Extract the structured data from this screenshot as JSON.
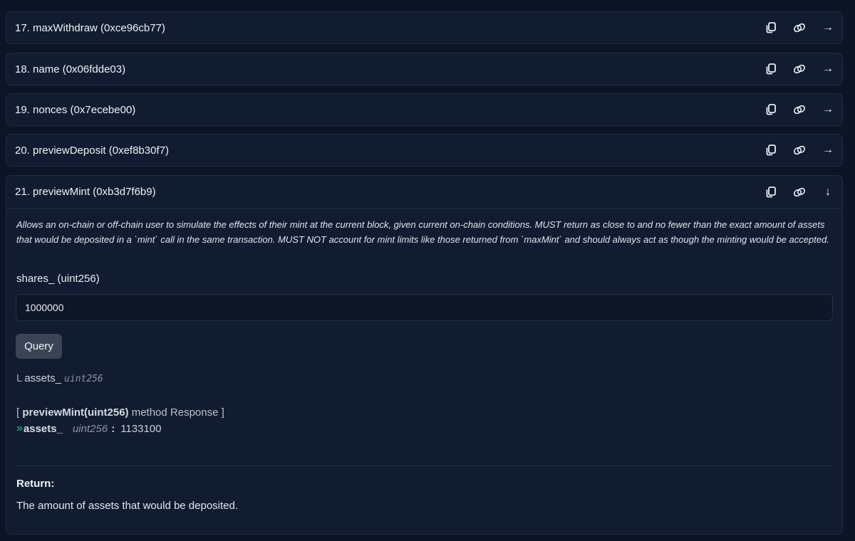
{
  "methods": [
    {
      "title": "17. maxWithdraw (0xce96cb77)",
      "arrow": "→"
    },
    {
      "title": "18. name (0x06fdde03)",
      "arrow": "→"
    },
    {
      "title": "19. nonces (0x7ecebe00)",
      "arrow": "→"
    },
    {
      "title": "20. previewDeposit (0xef8b30f7)",
      "arrow": "→"
    }
  ],
  "expanded": {
    "title": "21. previewMint (0xb3d7f6b9)",
    "arrow": "↓",
    "description": "Allows an on-chain or off-chain user to simulate the effects of their mint at the current block, given current on-chain conditions. MUST return as close to and no fewer than the exact amount of assets that would be deposited in a `mint` call in the same transaction. MUST NOT account for mint limits like those returned from `maxMint` and should always act as though the minting would be accepted.",
    "param_label": "shares_ (uint256)",
    "param_value": "1000000",
    "query_label": "Query",
    "output_corner": "L",
    "output_name": "assets_",
    "output_type": "uint256",
    "response_open": "[",
    "response_method": "previewMint(uint256)",
    "response_suffix": "method Response ]",
    "response_chevron": "»",
    "response_name": "assets_",
    "response_type": "uint256",
    "response_colon": ":",
    "response_value": "1133100",
    "return_label": "Return:",
    "return_text": "The amount of assets that would be deposited."
  },
  "icons": [
    "copy-icon",
    "link-icon",
    "arrow-right-icon",
    "arrow-down-icon"
  ],
  "colors": {
    "background": "#0c1425",
    "card": "#121c30",
    "border": "#222d42",
    "accent_chevron": "#22c58b",
    "button": "#3a4454"
  }
}
